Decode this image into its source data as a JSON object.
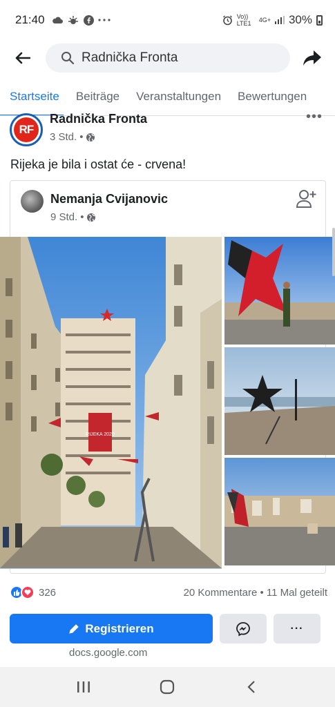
{
  "status_bar": {
    "time": "21:40",
    "notif_icons": [
      "cloud-icon",
      "weather-icon",
      "facebook-icon",
      "more-dots-icon"
    ],
    "network": "Vo)) LTE1",
    "network_type": "4G+",
    "battery": "30%"
  },
  "search": {
    "query": "Radnička Fronta"
  },
  "tabs": [
    {
      "label": "Startseite",
      "active": true
    },
    {
      "label": "Beiträge"
    },
    {
      "label": "Veranstaltungen"
    },
    {
      "label": "Bewertungen"
    }
  ],
  "post": {
    "author": "Radnička Fronta",
    "logo_text": "RF",
    "time": "3 Std.",
    "text": "Rijeka je bila i ostat će - crvena!",
    "shared": {
      "author": "Nemanja Cvijanovic",
      "time": "9 Std.",
      "banner_text": "RIJEKA 2020"
    },
    "reaction_count": "326",
    "comments_shares": "20 Kommentare • 11 Mal geteilt"
  },
  "actions": {
    "register_label": "Registrieren",
    "more_label": "···",
    "domain": "docs.google.com"
  },
  "colors": {
    "accent": "#1877f2",
    "love": "#f33e58",
    "brand_red": "#e1251b"
  }
}
